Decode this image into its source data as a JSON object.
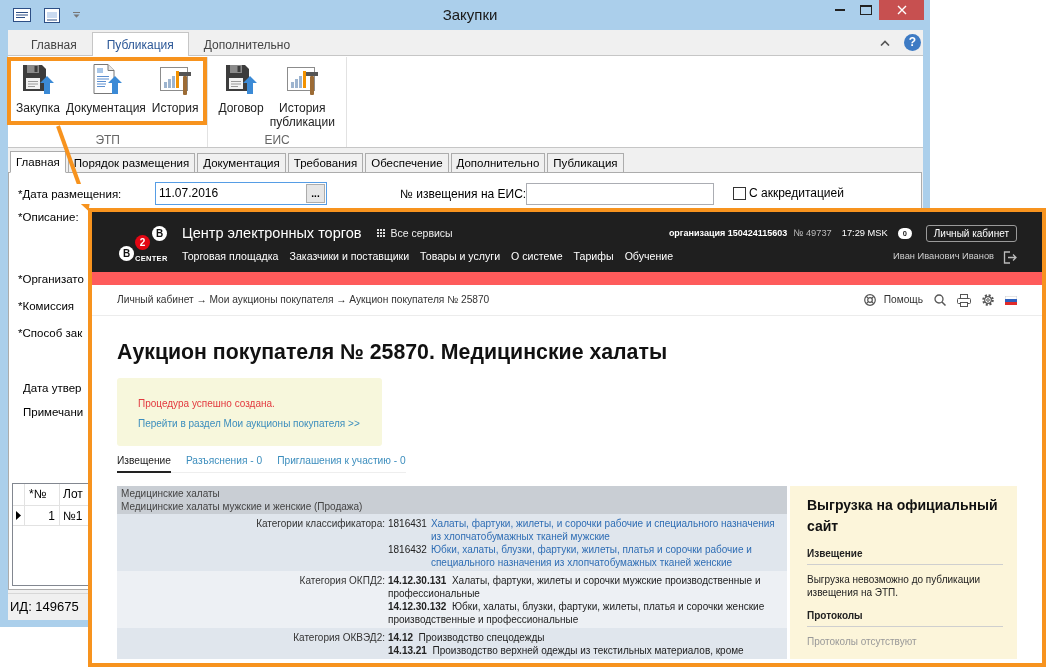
{
  "window": {
    "title": "Закупки"
  },
  "ribbon": {
    "tabs": [
      {
        "label": "Главная",
        "selected": false
      },
      {
        "label": "Публикация",
        "selected": true
      },
      {
        "label": "Дополнительно",
        "selected": false
      }
    ],
    "help": "?",
    "groups": [
      {
        "label": "ЭТП",
        "highlighted": true,
        "buttons": [
          {
            "label": "Закупка",
            "kind": "save"
          },
          {
            "label": "Документация",
            "kind": "document"
          },
          {
            "label": "История",
            "kind": "history"
          }
        ]
      },
      {
        "label": "ЕИС",
        "highlighted": false,
        "buttons": [
          {
            "label": "Договор",
            "kind": "save"
          },
          {
            "label": "История публикации",
            "kind": "history"
          }
        ]
      }
    ]
  },
  "form_tabs": [
    {
      "label": "Главная",
      "selected": true
    },
    {
      "label": "Порядок размещения",
      "selected": false
    },
    {
      "label": "Документация",
      "selected": false
    },
    {
      "label": "Требования",
      "selected": false
    },
    {
      "label": "Обеспечение",
      "selected": false
    },
    {
      "label": "Дополнительно",
      "selected": false
    },
    {
      "label": "Публикация",
      "selected": false
    }
  ],
  "form": {
    "date": {
      "label": "*Дата размещения:",
      "value": "11.07.2016",
      "button": "..."
    },
    "notice": {
      "label": "№ извещения на ЕИС:"
    },
    "accreditation": {
      "label": "С аккредитацией",
      "checked": false
    },
    "fields": [
      "*Описание:",
      "*Организато",
      "*Комиссия",
      "*Способ зак",
      "Дата утвер",
      "Примечани"
    ]
  },
  "lots": {
    "columns": [
      "*№",
      "Лот"
    ],
    "rows": [
      {
        "selected": true,
        "cells": [
          "1",
          "№1"
        ]
      }
    ]
  },
  "status_bar": {
    "id": "ИД: 149675"
  },
  "site": {
    "logo": {
      "marks": [
        {
          "text": "B",
          "color": "#ffffff"
        },
        {
          "text": "2",
          "color": "#e30613"
        },
        {
          "text": "B",
          "color": "#ffffff"
        }
      ],
      "caption": "CENTER"
    },
    "title": "Центр электронных торгов",
    "services": "Все сервисы",
    "account": {
      "organization": "организация 150424115603",
      "number": "№ 49737",
      "time": "17:29 MSK",
      "messages": "0",
      "cabinet": "Личный кабинет",
      "user": "Иван Иванович Иванов"
    },
    "nav": [
      "Торговая площадка",
      "Заказчики и поставщики",
      "Товары и услуги",
      "О системе",
      "Тарифы",
      "Обучение"
    ],
    "breadcrumb": "Личный кабинет → Мои аукционы покупателя → Аукцион покупателя № 25870",
    "help": "Помощь",
    "heading": "Аукцион покупателя № 25870. Медицинские халаты",
    "alert": {
      "message": "Процедура успешно создана.",
      "link": "Перейти в раздел Мои аукционы покупателя >>"
    },
    "tabs": [
      {
        "label": "Извещение",
        "selected": true
      },
      {
        "label": "Разъяснения - 0",
        "selected": false
      },
      {
        "label": "Приглашения к участию - 0",
        "selected": false
      }
    ],
    "details": {
      "title": "Медицинские халаты",
      "subtitle": "Медицинские халаты мужские и женские (Продажа)",
      "rows": [
        {
          "label": "Категории классификатора:",
          "kind": "classifier",
          "entries": [
            {
              "code": "1816431",
              "text": "Халаты, фартуки, жилеты, и сорочки рабочие и специального назначения из хлопчатобумажных тканей мужские"
            },
            {
              "code": "1816432",
              "text": "Юбки, халаты, блузки, фартуки, жилеты, платья и сорочки рабочие и специального назначения из хлопчатобумажных тканей женские"
            }
          ]
        },
        {
          "label": "Категория ОКПД2:",
          "kind": "code",
          "entries": [
            {
              "code": "14.12.30.131",
              "text": "Халаты, фартуки, жилеты и сорочки мужские производственные и профессиональные"
            },
            {
              "code": "14.12.30.132",
              "text": "Юбки, халаты, блузки, фартуки, жилеты, платья и сорочки женские производственные и профессиональные"
            }
          ]
        },
        {
          "label": "Категория ОКВЭД2:",
          "kind": "code",
          "entries": [
            {
              "code": "14.12",
              "text": "Производство спецодежды"
            },
            {
              "code": "14.13.21",
              "text": "Производство верхней одежды из текстильных материалов, кроме"
            }
          ]
        }
      ]
    },
    "sidebar": {
      "title": "Выгрузка на официальный сайт",
      "sections": [
        {
          "heading": "Извещение",
          "text": "Выгрузка невозможно до публикации извещения на ЭТП.",
          "muted": false
        },
        {
          "heading": "Протоколы",
          "text": "Протоколы отсутствуют",
          "muted": true
        }
      ]
    }
  }
}
